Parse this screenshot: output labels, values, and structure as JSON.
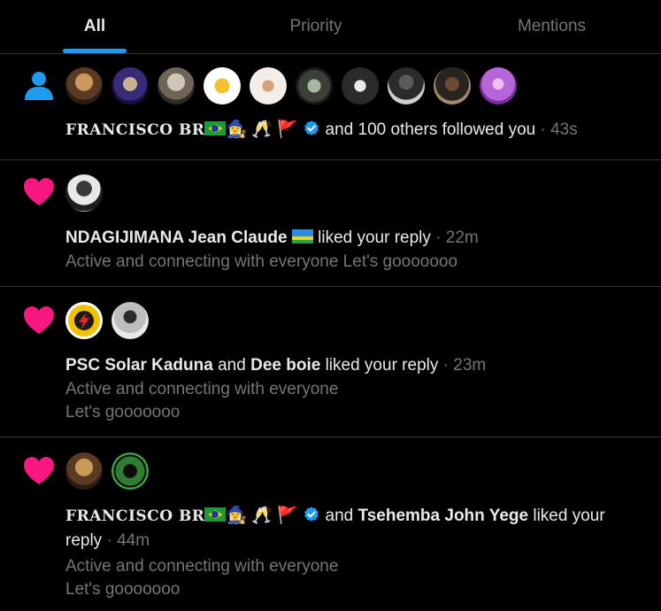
{
  "tabs": [
    {
      "label": "All",
      "active": true
    },
    {
      "label": "Priority",
      "active": false
    },
    {
      "label": "Mentions",
      "active": false
    }
  ],
  "colors": {
    "accent": "#1d9bf0",
    "like": "#f91880",
    "muted": "#71767b",
    "bg": "#000000"
  },
  "notifications": [
    {
      "type": "follow",
      "icon": "person-icon",
      "avatar_count": 11,
      "actor": "FRANCISCO BR",
      "actor_emojis": "🧙‍♀️ 🥂 🚩",
      "text": "and 100 others followed you",
      "time": "· 43s"
    },
    {
      "type": "like",
      "icon": "heart-icon",
      "actor": "NDAGIJIMANA Jean Claude",
      "text": "liked your reply",
      "time": "· 22m",
      "snippet": "Active and connecting with everyone Let's gooooooo"
    },
    {
      "type": "like",
      "icon": "heart-icon",
      "actor": "PSC Solar Kaduna",
      "conj": "and",
      "actor2": "Dee boie",
      "text": "liked your reply",
      "time": "· 23m",
      "snippet_line1": "Active and connecting with everyone",
      "snippet_line2": "Let's gooooooo"
    },
    {
      "type": "like",
      "icon": "heart-icon",
      "actor": "FRANCISCO BR",
      "actor_emojis": "🧙‍♀️ 🥂 🚩",
      "conj": "and",
      "actor2": "Tsehemba John Yege",
      "text": "liked your",
      "text2": "reply",
      "time": "· 44m",
      "snippet_line1": "Active and connecting with everyone",
      "snippet_line2": "Let's gooooooo"
    }
  ]
}
